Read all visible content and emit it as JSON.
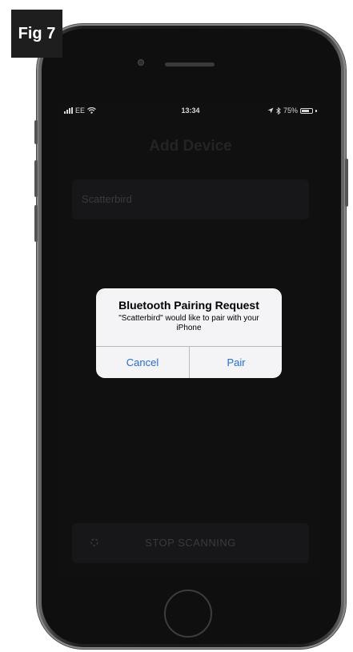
{
  "figure_label": "Fig 7",
  "status_bar": {
    "carrier": "EE",
    "time": "13:34",
    "battery": "75%",
    "battery_level": 0.75,
    "signal_icon": "signal-bars-icon",
    "wifi_icon": "wifi-icon",
    "location_icon": "location-arrow-icon",
    "bluetooth_icon": "bluetooth-icon",
    "battery_icon": "battery-icon"
  },
  "screen": {
    "title": "Add Device",
    "devices": [
      {
        "name": "Scatterbird"
      }
    ],
    "stop_button_label": "STOP SCANNING",
    "stop_button_icon": "scanning-icon"
  },
  "alert": {
    "title": "Bluetooth Pairing Request",
    "message": "\"Scatterbird\" would like to pair with your iPhone",
    "cancel_label": "Cancel",
    "pair_label": "Pair"
  },
  "colors": {
    "alert_button": "#1d6fe0",
    "screen_background": "#101011",
    "label_background": "#1e1e1e"
  }
}
